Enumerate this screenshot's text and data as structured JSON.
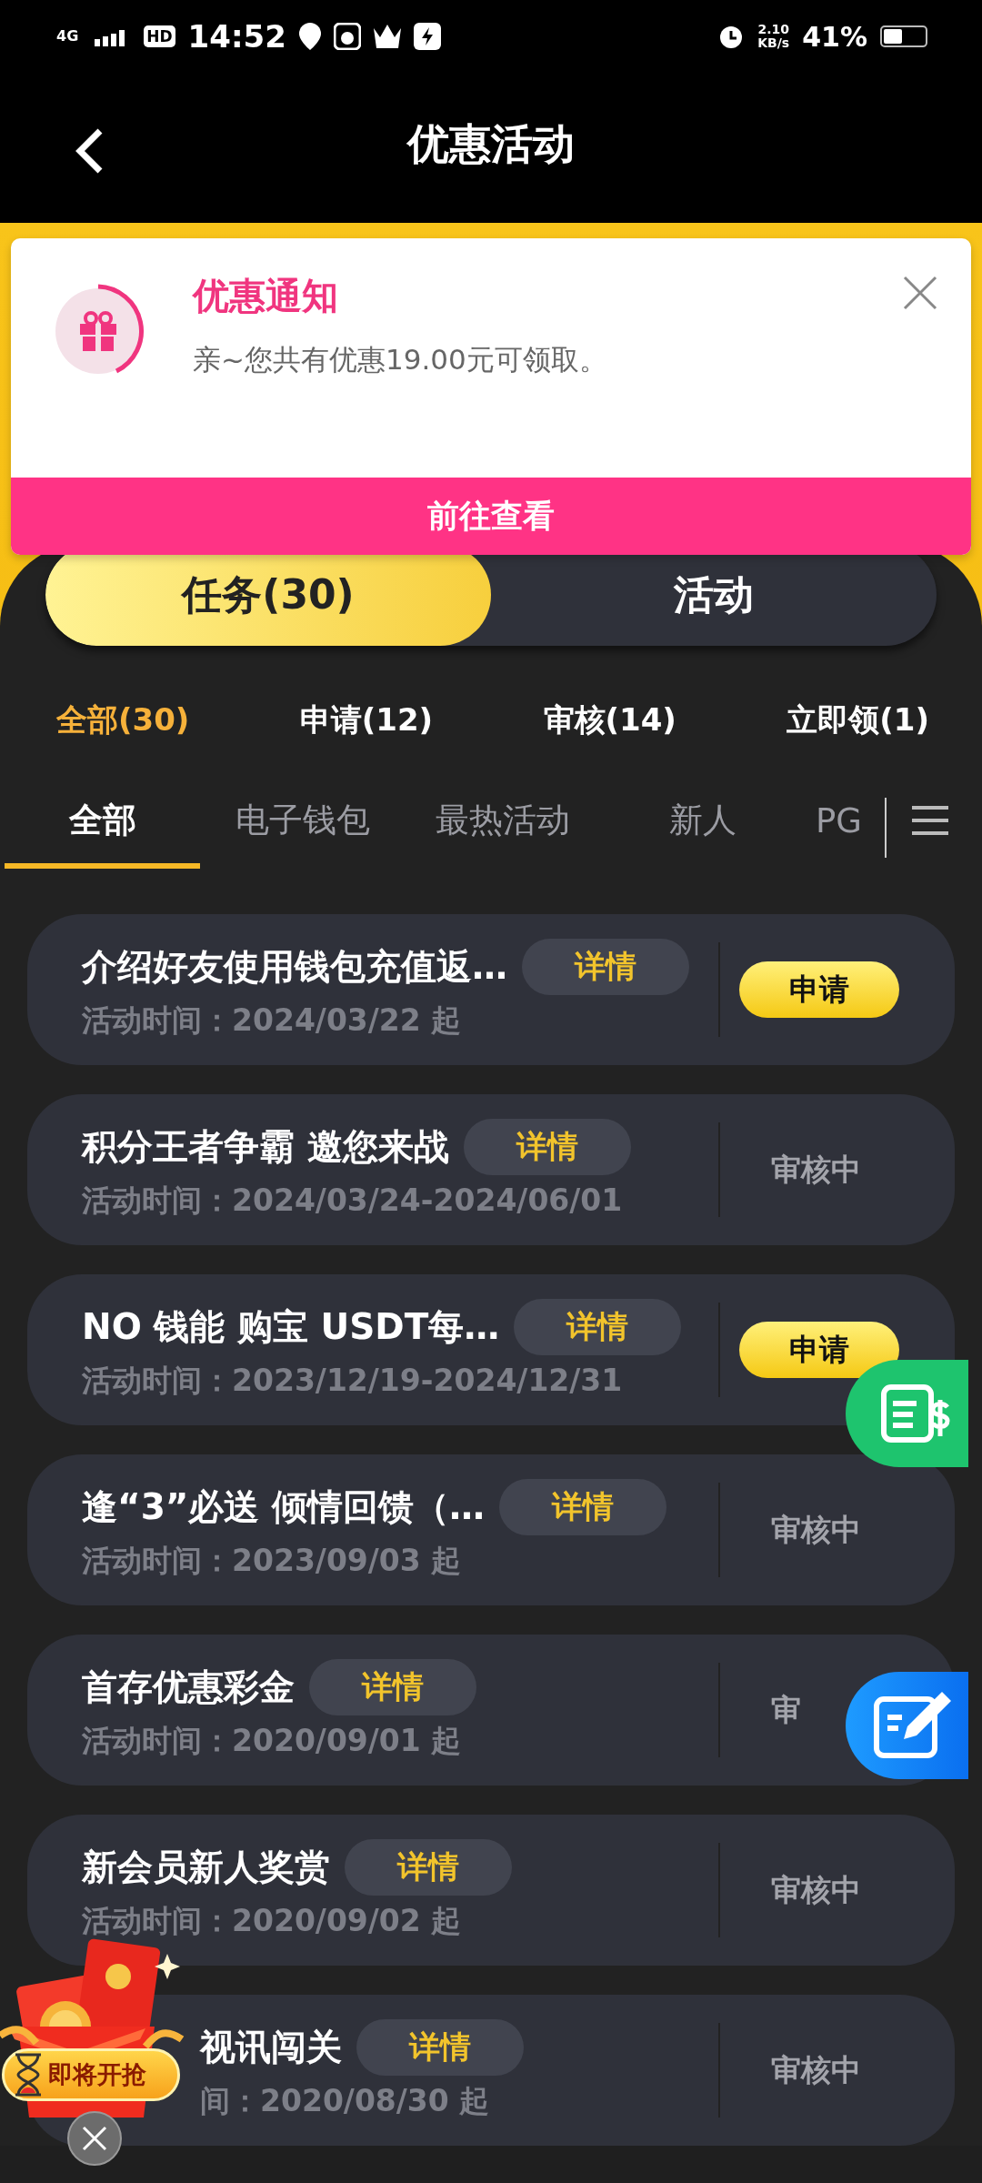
{
  "status_bar": {
    "network": "4G",
    "hd": "HD",
    "time": "14:52",
    "speed_value": "2.10",
    "speed_unit": "KB/s",
    "battery": "41%"
  },
  "header": {
    "title": "优惠活动"
  },
  "notice": {
    "title": "优惠通知",
    "message": "亲~您共有优惠19.00元可领取。",
    "action": "前往查看"
  },
  "segments": [
    {
      "label": "任务(30)",
      "selected": true
    },
    {
      "label": "活动",
      "selected": false
    }
  ],
  "filters": [
    {
      "label": "全部(30)",
      "selected": true
    },
    {
      "label": "申请(12)",
      "selected": false
    },
    {
      "label": "审核(14)",
      "selected": false
    },
    {
      "label": "立即领(1)",
      "selected": false
    }
  ],
  "tabs": [
    {
      "label": "全部",
      "selected": true
    },
    {
      "label": "电子钱包",
      "selected": false
    },
    {
      "label": "最热活动",
      "selected": false
    },
    {
      "label": "新人",
      "selected": false
    },
    {
      "label": "PG",
      "selected": false
    }
  ],
  "activities": [
    {
      "title": "介绍好友使用钱包充值返…",
      "time": "活动时间：2024/03/22 起",
      "details": "详情",
      "kind": "apply",
      "action": "申请",
      "covered": false
    },
    {
      "title": "积分王者争霸  邀您来战",
      "time": "活动时间：2024/03/24-2024/06/01",
      "details": "详情",
      "kind": "review",
      "action": "审核中",
      "covered": false
    },
    {
      "title": "NO 钱能 购宝 USDT每…",
      "time": "活动时间：2023/12/19-2024/12/31",
      "details": "详情",
      "kind": "apply",
      "action": "申请",
      "covered": false
    },
    {
      "title": "逢“3”必送 倾情回馈（…",
      "time": "活动时间：2023/09/03 起",
      "details": "详情",
      "kind": "review",
      "action": "审核中",
      "covered": false
    },
    {
      "title": "首存优惠彩金",
      "time": "活动时间：2020/09/01 起",
      "details": "详情",
      "kind": "review",
      "action": "审",
      "covered": false
    },
    {
      "title": "新会员新人奖赏",
      "time": "活动时间：2020/09/02 起",
      "details": "详情",
      "kind": "review",
      "action": "审核中",
      "covered": false
    },
    {
      "title": "视讯闯关",
      "time": "间：2020/08/30 起",
      "details": "详情",
      "kind": "review",
      "action": "审核中",
      "covered": true
    }
  ],
  "promo_badge": {
    "label": "即将开抢"
  }
}
